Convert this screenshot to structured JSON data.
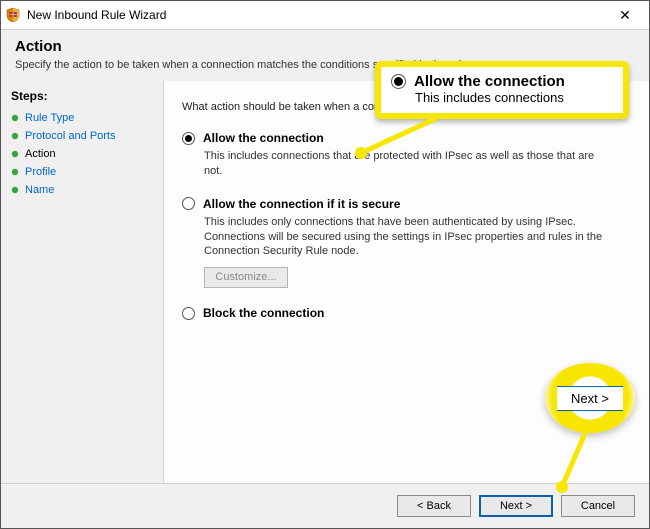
{
  "window": {
    "title": "New Inbound Rule Wizard",
    "close_glyph": "✕"
  },
  "header": {
    "title": "Action",
    "subtitle": "Specify the action to be taken when a connection matches the conditions specified in the rule."
  },
  "sidebar": {
    "label": "Steps:",
    "items": [
      {
        "label": "Rule Type",
        "current": false
      },
      {
        "label": "Protocol and Ports",
        "current": false
      },
      {
        "label": "Action",
        "current": true
      },
      {
        "label": "Profile",
        "current": false
      },
      {
        "label": "Name",
        "current": false
      }
    ]
  },
  "content": {
    "prompt": "What action should be taken when a connection matches the specified conditions?",
    "options": [
      {
        "label": "Allow the connection",
        "desc": "This includes connections that are protected with IPsec as well as those that are not.",
        "checked": true
      },
      {
        "label": "Allow the connection if it is secure",
        "desc": "This includes only connections that have been authenticated by using IPsec. Connections will be secured using the settings in IPsec properties and rules in the Connection Security Rule node.",
        "checked": false,
        "customize_label": "Customize..."
      },
      {
        "label": "Block the connection",
        "desc": "",
        "checked": false
      }
    ]
  },
  "footer": {
    "back": "< Back",
    "next": "Next >",
    "cancel": "Cancel"
  },
  "callouts": {
    "allow_label": "Allow the connection",
    "allow_desc": "This includes connections",
    "next_label": "Next >"
  }
}
